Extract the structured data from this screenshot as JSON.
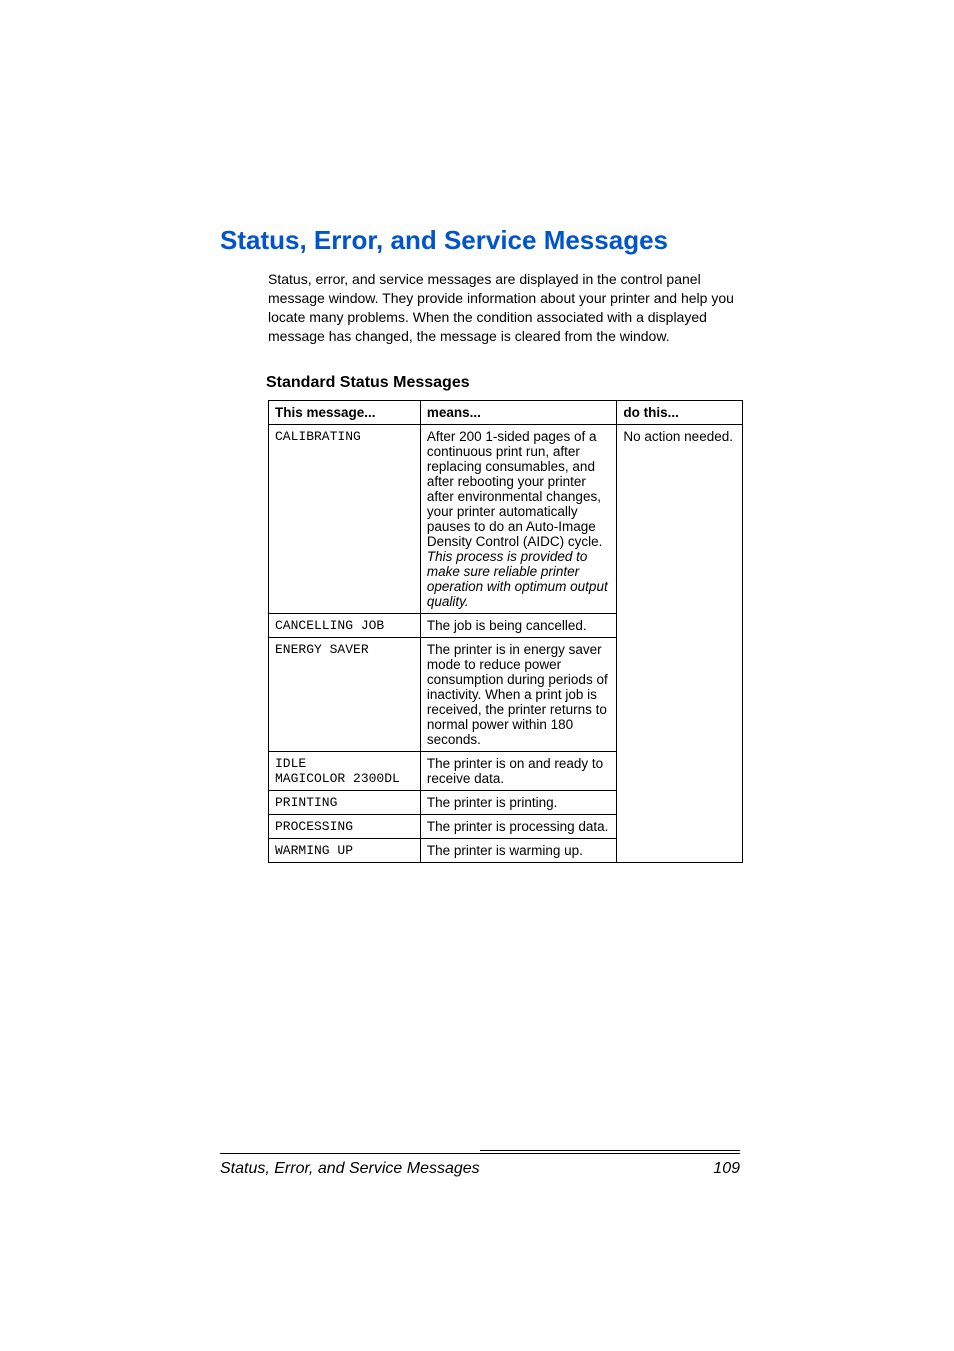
{
  "title": "Status, Error, and Service Messages",
  "intro": "Status, error, and service messages are displayed in the control panel message window. They provide information about your printer and help you locate many problems. When the condition associated with a displayed message has changed, the message is cleared from the window.",
  "subtitle": "Standard Status Messages",
  "table": {
    "headers": {
      "col1": "This message...",
      "col2": "means...",
      "col3": "do this..."
    },
    "rows": [
      {
        "message": "CALIBRATING",
        "means_plain": "After 200 1-sided pages of a continuous print run, after replacing consumables, and after rebooting your printer after environmental changes, your printer automatically pauses to do an Auto-Image Density Control (AIDC) cycle. ",
        "means_italic": "This process is provided to make sure reliable printer operation with optimum output quality."
      },
      {
        "message": "CANCELLING JOB",
        "means": "The job is being cancelled."
      },
      {
        "message": "ENERGY SAVER",
        "means": "The printer is in energy saver mode to reduce power consumption during periods of inactivity. When a print job is received, the printer returns to normal power within 180 seconds."
      },
      {
        "message": "IDLE\nMAGICOLOR 2300DL",
        "means": "The printer is on and ready to receive data."
      },
      {
        "message": "PRINTING",
        "means": "The printer is printing."
      },
      {
        "message": "PROCESSING",
        "means": "The printer is processing data."
      },
      {
        "message": "WARMING UP",
        "means": "The printer is warming up."
      }
    ],
    "action": "No action needed."
  },
  "footer": {
    "left": "Status, Error, and Service Messages",
    "right": "109"
  }
}
